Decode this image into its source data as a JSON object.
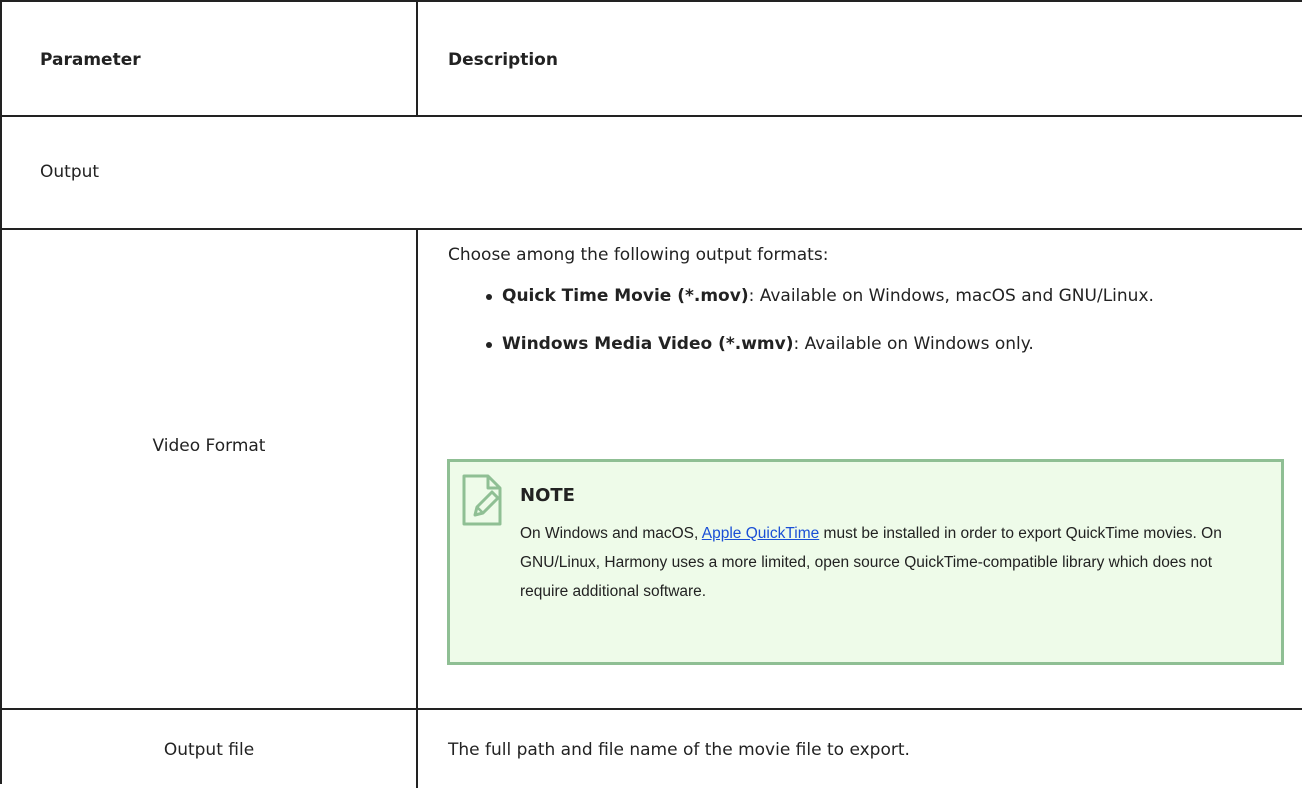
{
  "table": {
    "header": {
      "parameter": "Parameter",
      "description": "Description"
    },
    "section": "Output",
    "rows": [
      {
        "parameter": "Video Format",
        "intro": "Choose among the following output formats:",
        "bullets": [
          {
            "bold": "Quick Time Movie (*.mov)",
            "text": ": Available on Windows, macOS and GNU/Linux."
          },
          {
            "bold": "Windows Media Video (*.wmv)",
            "text": ": Available on Windows only."
          }
        ],
        "note": {
          "icon": "note-edit-icon",
          "title": "NOTE",
          "text_before": "On Windows and macOS, ",
          "link_text": "Apple QuickTime",
          "text_after": " must be installed in order to export QuickTime movies. On GNU/Linux, Harmony uses a more limited, open source QuickTime-compatible library which does not require additional software."
        }
      },
      {
        "parameter": "Output file",
        "description": "The full path and file name of the movie file to export."
      }
    ]
  },
  "colors": {
    "border": "#222222",
    "note_border": "#8fbf94",
    "note_background": "#eefbe9",
    "link": "#1a4fd6"
  }
}
